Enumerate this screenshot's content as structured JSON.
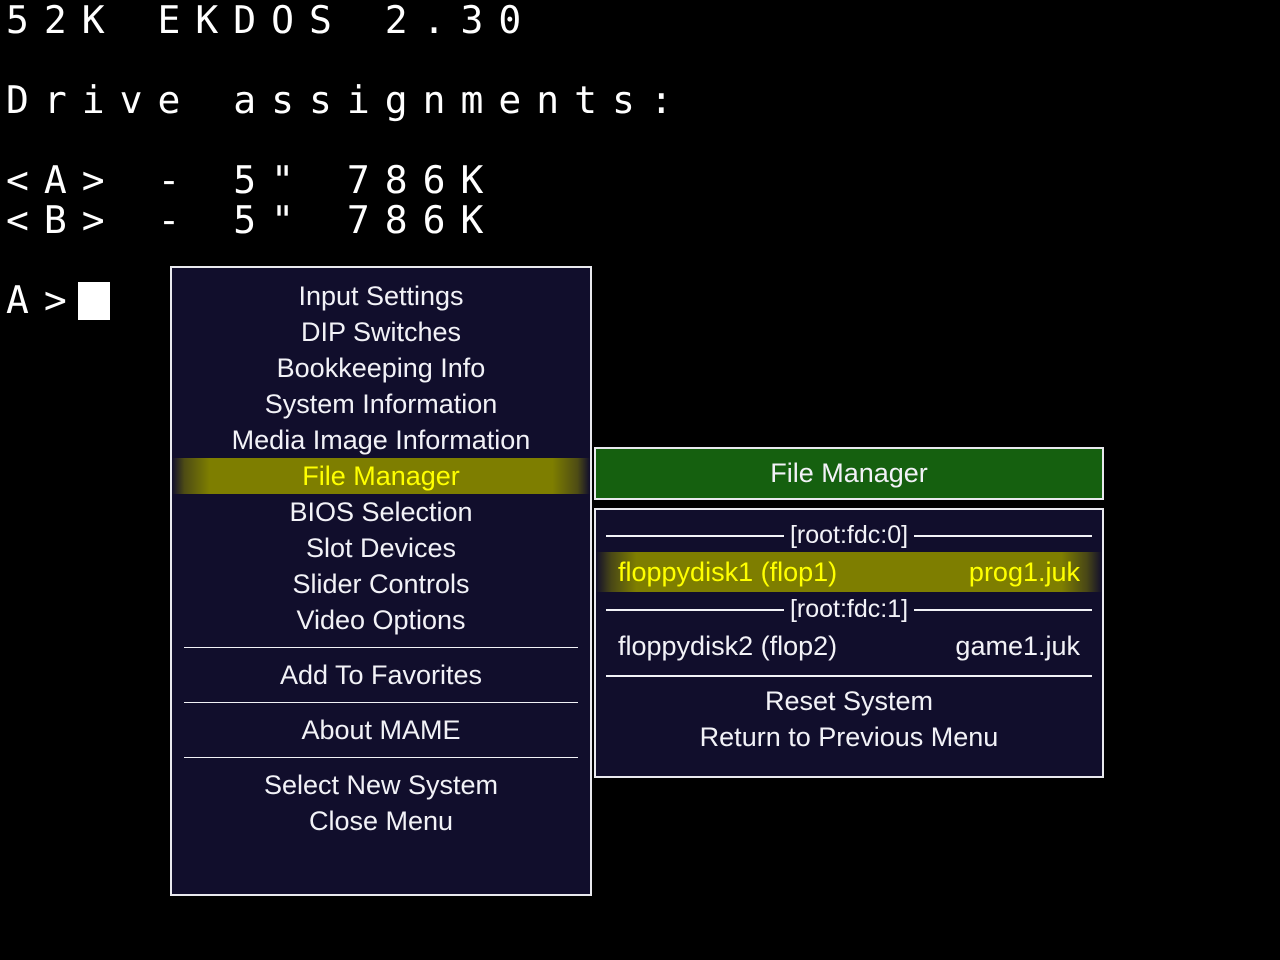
{
  "machine_screen": {
    "title": "52K EKDOS 2.30",
    "drive_heading": "Drive assignments:",
    "drive_a": "<A> - 5\" 786K",
    "drive_b": "<B> - 5\" 786K",
    "prompt": "A>",
    "cursor": "block-cursor"
  },
  "main_menu": {
    "items": [
      {
        "label": "Input Settings",
        "selected": false
      },
      {
        "label": "DIP Switches",
        "selected": false
      },
      {
        "label": "Bookkeeping Info",
        "selected": false
      },
      {
        "label": "System Information",
        "selected": false
      },
      {
        "label": "Media Image Information",
        "selected": false
      },
      {
        "label": "File Manager",
        "selected": true
      },
      {
        "label": "BIOS Selection",
        "selected": false
      },
      {
        "label": "Slot Devices",
        "selected": false
      },
      {
        "label": "Slider Controls",
        "selected": false
      },
      {
        "label": "Video Options",
        "selected": false
      }
    ],
    "favorites_item": "Add To Favorites",
    "about_item": "About MAME",
    "select_new_system_item": "Select New System",
    "close_menu_item": "Close Menu"
  },
  "file_manager": {
    "title": "File Manager",
    "sections": [
      {
        "heading": "[root:fdc:0]",
        "device": "floppydisk1 (flop1)",
        "image": "prog1.juk",
        "selected": true
      },
      {
        "heading": "[root:fdc:1]",
        "device": "floppydisk2 (flop2)",
        "image": "game1.juk",
        "selected": false
      }
    ],
    "actions": [
      "Reset System",
      "Return to Previous Menu"
    ]
  },
  "colors": {
    "panel_background": "#110e2c",
    "panel_border": "#e9e9ee",
    "title_green": "#15600f",
    "highlight_olive": "#7e7e00",
    "highlight_text": "#ffff00",
    "text": "#f2f2f7",
    "screen_background": "#000000",
    "terminal_text": "#ffffff"
  }
}
